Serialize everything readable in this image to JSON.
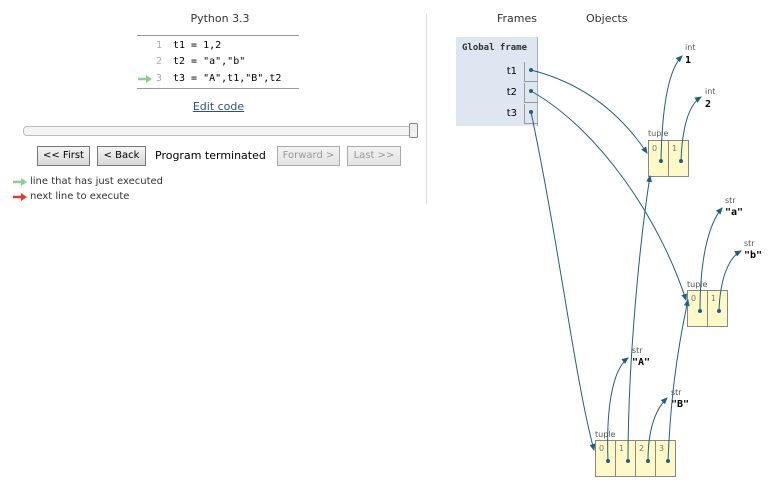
{
  "editor": {
    "language": "Python 3.3",
    "lines": [
      {
        "num": "1",
        "code": "t1 = 1,2"
      },
      {
        "num": "2",
        "code": "t2 = \"a\",\"b\""
      },
      {
        "num": "3",
        "code": "t3 = \"A\",t1,\"B\",t2"
      }
    ],
    "executed_line": 3,
    "edit_link": "Edit code"
  },
  "navigation": {
    "first_label": "<< First",
    "back_label": "< Back",
    "status": "Program terminated",
    "forward_label": "Forward >",
    "last_label": "Last >>",
    "slider_progress": 1.0
  },
  "legend": {
    "executed_label": "line that has just executed",
    "next_label": "next line to execute",
    "executed_color": "#8fce8f",
    "next_color": "#e33b2c"
  },
  "viz": {
    "frames_header": "Frames",
    "objects_header": "Objects",
    "global_frame_title": "Global frame",
    "variables": [
      "t1",
      "t2",
      "t3"
    ],
    "objects": {
      "int1": {
        "type": "int",
        "value": "1"
      },
      "int2": {
        "type": "int",
        "value": "2"
      },
      "tuple_t1": {
        "type": "tuple",
        "indices": [
          "0",
          "1"
        ]
      },
      "str_a": {
        "type": "str",
        "value": "\"a\""
      },
      "str_b": {
        "type": "str",
        "value": "\"b\""
      },
      "tuple_t2": {
        "type": "tuple",
        "indices": [
          "0",
          "1"
        ]
      },
      "str_A": {
        "type": "str",
        "value": "\"A\""
      },
      "str_B": {
        "type": "str",
        "value": "\"B\""
      },
      "tuple_t3": {
        "type": "tuple",
        "indices": [
          "0",
          "1",
          "2",
          "3"
        ]
      }
    },
    "arrow_color": "#1f5f82"
  }
}
